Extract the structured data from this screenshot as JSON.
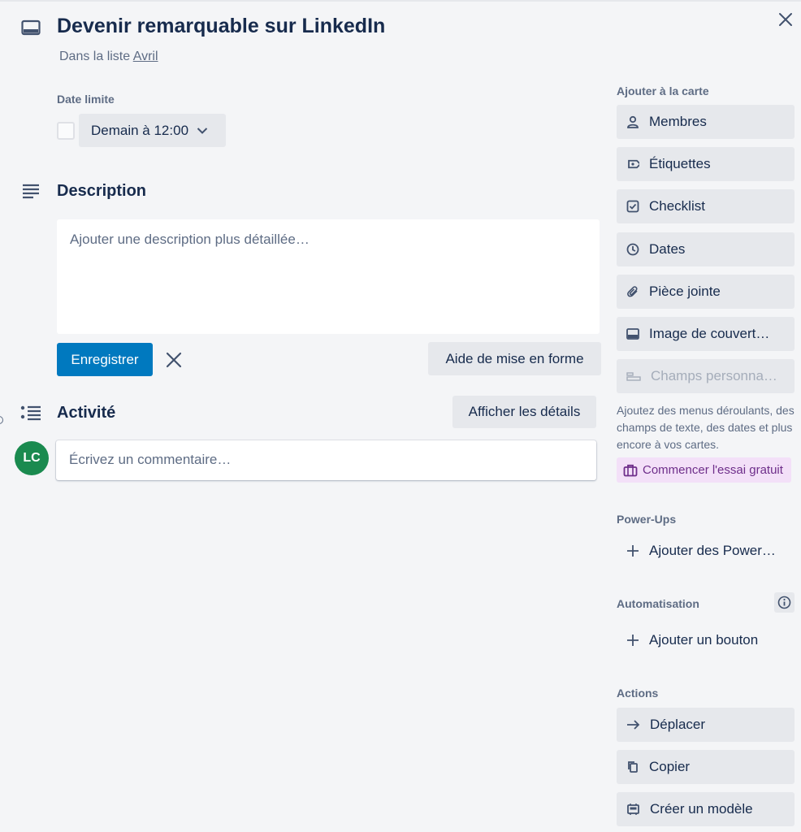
{
  "header": {
    "title": "Devenir remarquable sur LinkedIn",
    "list_prefix": "Dans la liste ",
    "list_name": "Avril",
    "icons": {
      "card": "card-icon",
      "close": "close-icon"
    }
  },
  "due_date": {
    "label": "Date limite",
    "value": "Demain à 12:00",
    "completed": false
  },
  "description": {
    "title": "Description",
    "placeholder": "Ajouter une description plus détaillée…",
    "save_label": "Enregistrer",
    "format_help_label": "Aide de mise en forme"
  },
  "activity": {
    "title": "Activité",
    "details_label": "Afficher les détails",
    "avatar_initials": "LC",
    "comment_placeholder": "Écrivez un commentaire…"
  },
  "sidebar": {
    "add_heading": "Ajouter à la carte",
    "add_items": [
      {
        "label": "Membres",
        "icon": "person-icon"
      },
      {
        "label": "Étiquettes",
        "icon": "tag-icon"
      },
      {
        "label": "Checklist",
        "icon": "checklist-icon"
      },
      {
        "label": "Dates",
        "icon": "clock-icon"
      },
      {
        "label": "Pièce jointe",
        "icon": "paperclip-icon"
      },
      {
        "label": "Image de couvert…",
        "icon": "cover-icon"
      },
      {
        "label": "Champs personna…",
        "icon": "custom-fields-icon",
        "disabled": true
      }
    ],
    "custom_fields_note": "Ajoutez des menus déroulants, des champs de texte, des dates et plus encore à vos cartes.",
    "trial_label": "Commencer l'essai gratuit",
    "powerups_heading": "Power-Ups",
    "powerups_add": "Ajouter des Power…",
    "automation_heading": "Automatisation",
    "automation_add": "Ajouter un bouton",
    "actions_heading": "Actions",
    "actions": [
      {
        "label": "Déplacer",
        "icon": "arrow-right-icon"
      },
      {
        "label": "Copier",
        "icon": "copy-icon"
      },
      {
        "label": "Créer un modèle",
        "icon": "template-icon"
      }
    ]
  },
  "colors": {
    "background": "#f4f5f7",
    "primary_button": "#0079bf",
    "avatar": "#1a8a4f",
    "trial_bg": "#f3e0f8",
    "trial_text": "#6e2e8a"
  }
}
